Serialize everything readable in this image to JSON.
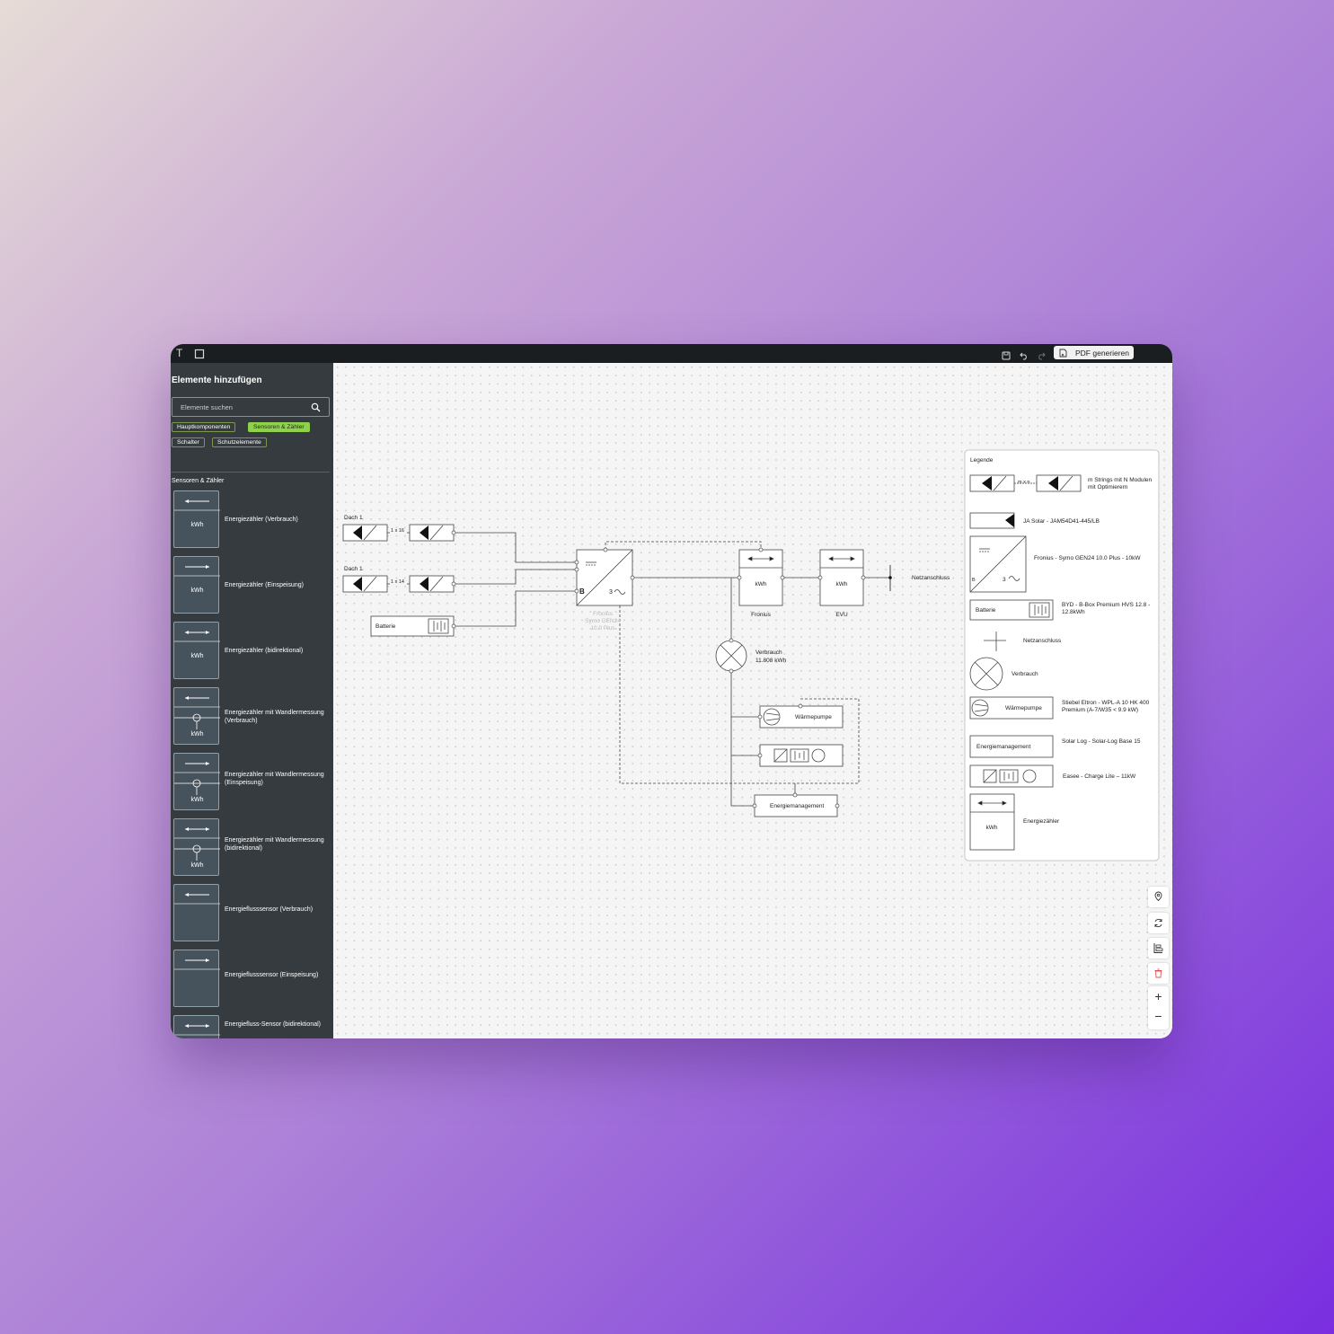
{
  "toolbar": {
    "text_tool": "T",
    "pdf_button": "PDF generieren"
  },
  "sidebar": {
    "title": "Elemente hinzufügen",
    "search_placeholder": "Elemente suchen",
    "chips": [
      "Hauptkomponenten",
      "Sensoren & Zähler",
      "Schalter",
      "Schutzelemente"
    ],
    "active_chip": "Sensoren & Zähler",
    "section": "Sensoren & Zähler",
    "items": [
      {
        "label": "Energiezähler (Verbrauch)",
        "icon": "meter-consumption-icon",
        "tile_text": "kWh"
      },
      {
        "label": "Energiezähler (Einspeisung)",
        "icon": "meter-feedin-icon",
        "tile_text": "kWh"
      },
      {
        "label": "Energiezähler (bidirektional)",
        "icon": "meter-bidirectional-icon",
        "tile_text": "kWh"
      },
      {
        "label": "Energiezähler mit Wandlermessung (Verbrauch)",
        "icon": "meter-ct-consumption-icon",
        "tile_text": "kWh"
      },
      {
        "label": "Energiezähler mit Wandlermessung (Einspeisung)",
        "icon": "meter-ct-feedin-icon",
        "tile_text": "kWh"
      },
      {
        "label": "Energiezähler mit Wandlermessung (bidirektional)",
        "icon": "meter-ct-bidirectional-icon",
        "tile_text": "kWh"
      },
      {
        "label": "Energieflusssensor (Verbrauch)",
        "icon": "flow-sensor-consumption-icon",
        "tile_text": ""
      },
      {
        "label": "Energieflusssensor (Einspeisung)",
        "icon": "flow-sensor-feedin-icon",
        "tile_text": ""
      },
      {
        "label": "Energiefluss-Sensor (bidirektional)",
        "icon": "flow-sensor-bidirectional-icon",
        "tile_text": ""
      }
    ]
  },
  "diagram": {
    "dach1_top": "Dach 1",
    "dach1_bottom": "Dach 1",
    "string_top": "1 x 16",
    "string_bottom": "1 x 14",
    "battery": "Batterie",
    "inverter_b": "B",
    "inverter_3": "3",
    "inverter_label": [
      "Fronius",
      "Symo GEN24",
      "10.0 Plus"
    ],
    "meter_kwh": "kWh",
    "meter_fronius": "Fronius",
    "meter_evu": "EVU",
    "grid": "Netzanschluss",
    "consumption_label": "Verbrauch",
    "consumption_value": "11.808 kWh",
    "heatpump": "Wärmepumpe",
    "energy_mgmt": "Energiemanagement"
  },
  "legend": {
    "title": "Legende",
    "mxn": "m x n",
    "strings": "m Strings mit N Modulen mit Optimierern",
    "module": "JA Solar - JAM54D41-445/LB",
    "inverter": "Fronius - Symo GEN24 10.0 Plus - 10kW",
    "inverter_b": "B",
    "inverter_3": "3",
    "battery_box": "Batterie",
    "battery": "BYD - B-Box Premium HVS 12.8 - 12.8kWh",
    "grid": "Netzanschluss",
    "consumption": "Verbrauch",
    "heatpump_box": "Wärmepumpe",
    "heatpump": "Stiebel Eltron - WPL-A 10 HK 400 Premium (A-7/W35 < 9.9 kW)",
    "em_box": "Energiemanagement",
    "em": "Solar Log - Solar-Log Base 15",
    "charger": "Easee - Charge Lite – 11kW",
    "meter_kwh": "kWh",
    "meter": "Energiezähler"
  },
  "controls": [
    "location-pin-icon",
    "refresh-icon",
    "align-icon",
    "trash-icon",
    "zoom-in-icon",
    "zoom-out-icon"
  ],
  "colors": {
    "accent": "#8ed14a",
    "sidebar": "#353b3f",
    "topbar": "#1b1e21",
    "danger": "#e05050"
  }
}
